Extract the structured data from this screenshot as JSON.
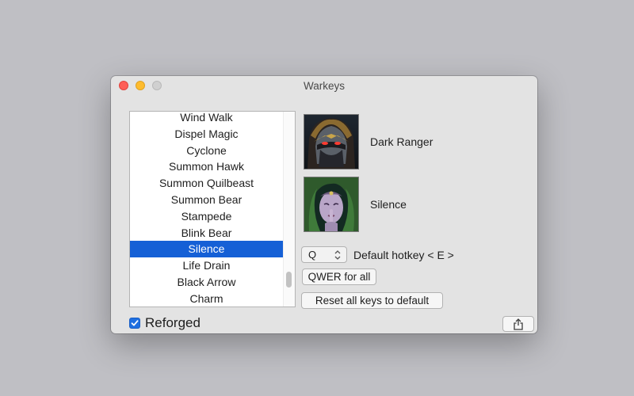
{
  "window": {
    "title": "Warkeys"
  },
  "ability_list": {
    "items": [
      "Wind Walk",
      "Dispel Magic",
      "Cyclone",
      "Summon Hawk",
      "Summon Quilbeast",
      "Summon Bear",
      "Stampede",
      "Blink Bear",
      "Silence",
      "Life Drain",
      "Black Arrow",
      "Charm"
    ],
    "selected": "Silence"
  },
  "hero": {
    "name": "Dark Ranger",
    "portrait_icon": "dark-ranger-portrait"
  },
  "ability": {
    "name": "Silence",
    "portrait_icon": "silence-ability-portrait"
  },
  "hotkey": {
    "value": "Q",
    "default_label": "Default hotkey < E >"
  },
  "buttons": {
    "qwer_label": "QWER for all",
    "reset_label": "Reset all keys to default",
    "share_icon": "share-icon"
  },
  "reforged": {
    "label": "Reforged",
    "checked": true
  },
  "colors": {
    "selection": "#1560d6",
    "close": "#fe5f57",
    "minimize": "#febc2e",
    "checkbox": "#1f6fe0"
  }
}
